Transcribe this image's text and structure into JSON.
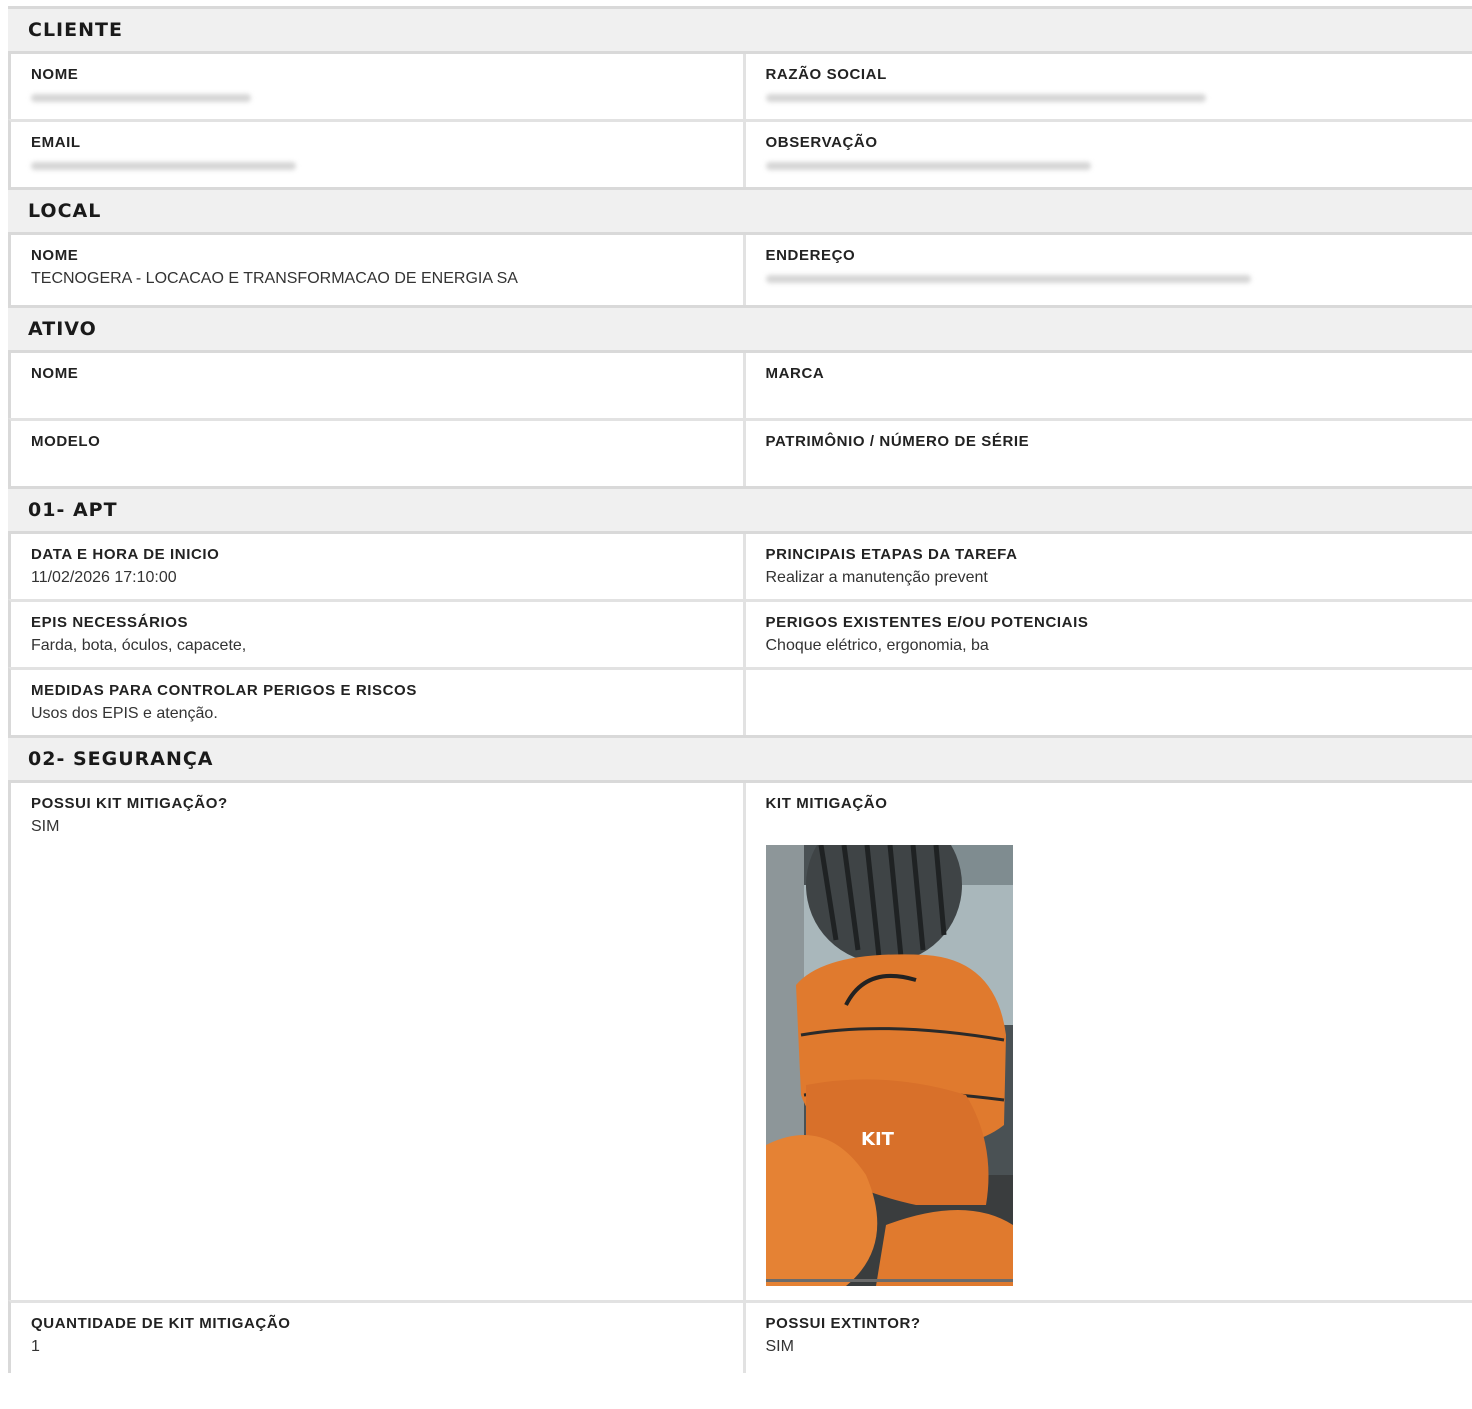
{
  "cliente": {
    "title": "CLIENTE",
    "nome_label": "NOME",
    "razao_label": "RAZÃO SOCIAL",
    "email_label": "EMAIL",
    "obs_label": "OBSERVAÇÃO"
  },
  "local": {
    "title": "LOCAL",
    "nome_label": "NOME",
    "nome_value": "TECNOGERA - LOCACAO E TRANSFORMACAO DE ENERGIA SA",
    "endereco_label": "ENDEREÇO"
  },
  "ativo": {
    "title": "ATIVO",
    "nome_label": "NOME",
    "marca_label": "MARCA",
    "modelo_label": "MODELO",
    "patrimonio_label": "PATRIMÔNIO / NÚMERO DE SÉRIE"
  },
  "apt": {
    "title": "01- APT",
    "data_label": "DATA E HORA DE INICIO",
    "data_value": "11/02/2026 17:10:00",
    "etapas_label": "PRINCIPAIS ETAPAS DA TAREFA",
    "etapas_value": "Realizar a  manutenção prevent",
    "epis_label": "EPIS NECESSÁRIOS",
    "epis_value": "Farda, bota, óculos, capacete,",
    "perigos_label": "PERIGOS EXISTENTES E/OU POTENCIAIS",
    "perigos_value": "Choque elétrico, ergonomia, ba",
    "medidas_label": "MEDIDAS PARA CONTROLAR PERIGOS E RISCOS",
    "medidas_value": "Usos dos EPIS e atenção."
  },
  "seguranca": {
    "title": "02- SEGURANÇA",
    "kit_label": "POSSUI KIT MITIGAÇÃO?",
    "kit_value": "SIM",
    "kit_photo_label": "KIT MITIGAÇÃO",
    "qtd_label": "QUANTIDADE DE KIT MITIGAÇÃO",
    "qtd_value": "1",
    "extintor_label": "POSSUI EXTINTOR?",
    "extintor_value": "SIM"
  },
  "colors": {
    "header_bg": "#f0f0f0",
    "border": "#d9d9d9",
    "bag_orange": "#e07a2e"
  }
}
